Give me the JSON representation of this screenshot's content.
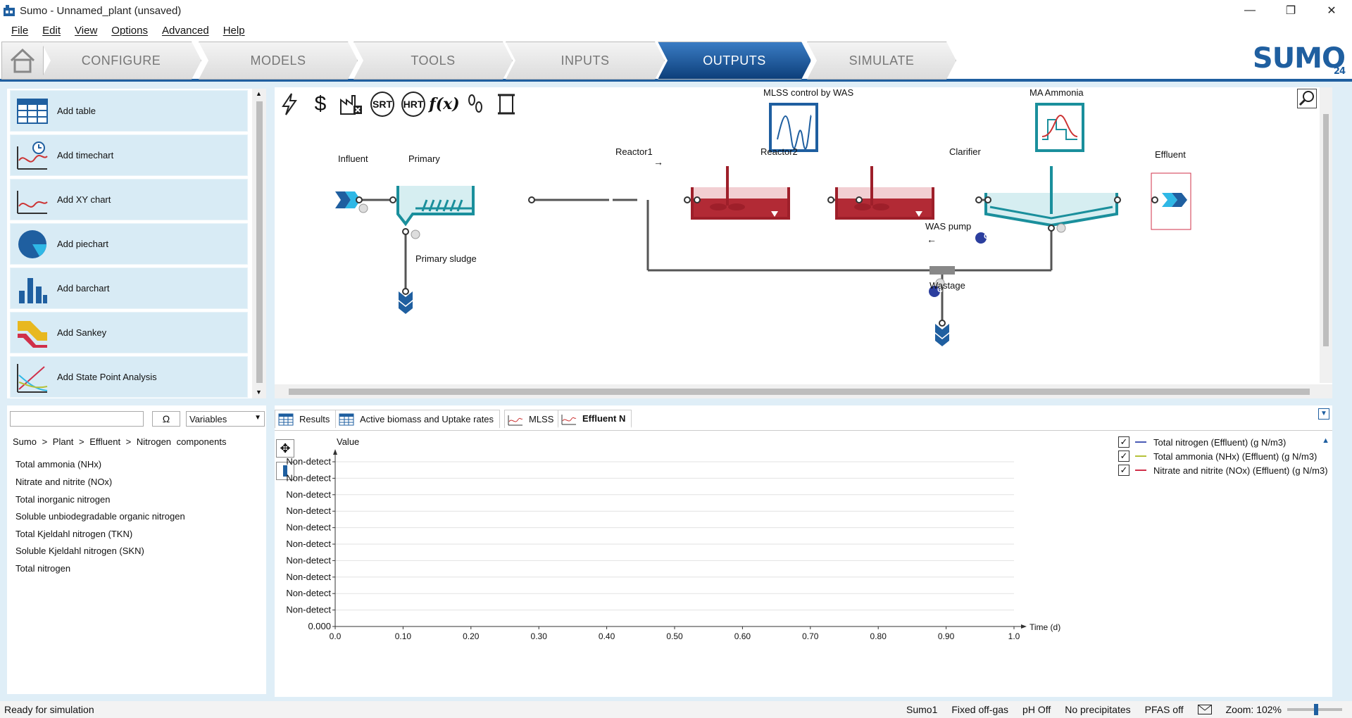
{
  "window": {
    "title": "Sumo - Unnamed_plant (unsaved)",
    "minimize": "—",
    "maximize": "❐",
    "close": "✕"
  },
  "menu": [
    "File",
    "Edit",
    "View",
    "Options",
    "Advanced",
    "Help"
  ],
  "ribbon": {
    "tabs": [
      "CONFIGURE",
      "MODELS",
      "TOOLS",
      "INPUTS",
      "OUTPUTS",
      "SIMULATE"
    ],
    "active_tab": "OUTPUTS",
    "logo": "SUMO",
    "logo_version": "24"
  },
  "add_panel": {
    "items": [
      "Add table",
      "Add timechart",
      "Add XY chart",
      "Add piechart",
      "Add barchart",
      "Add Sankey",
      "Add State Point Analysis"
    ]
  },
  "toolbar_icons": [
    "lightning-icon",
    "dollar-icon",
    "factory-x-icon",
    "SRT",
    "HRT",
    "f(x)-icon",
    "footprint-icon",
    "scroll-icon"
  ],
  "toolbar_labels": {
    "srt": "SRT",
    "hrt": "HRT"
  },
  "flowsheet": {
    "controllers": [
      {
        "label": "MLSS control by WAS"
      },
      {
        "label": "MA Ammonia"
      }
    ],
    "units": {
      "influent": "Influent",
      "primary": "Primary",
      "reactor1": "Reactor1",
      "reactor2": "Reactor2",
      "clarifier": "Clarifier",
      "effluent": "Effluent",
      "primary_sludge": "Primary sludge",
      "was_pump": "WAS pump",
      "wastage": "Wastage"
    },
    "controller_badge": "C",
    "arrow_right": "→",
    "arrow_left": "←"
  },
  "variable_browser": {
    "search_value": "",
    "omega": "Ω",
    "filter": "Variables",
    "breadcrumb": "Sumo  >  Plant  >  Effluent  >  Nitrogen components",
    "items": [
      "Total ammonia (NHx)",
      "Nitrate and nitrite (NOx)",
      "Total inorganic nitrogen",
      "Soluble unbiodegradable organic nitrogen",
      "Total Kjeldahl nitrogen (TKN)",
      "Soluble Kjeldahl nitrogen (SKN)",
      "Total nitrogen"
    ]
  },
  "chart_tabs": [
    "Results",
    "Active biomass and Uptake rates",
    "MLSS",
    "Effluent N"
  ],
  "active_chart_tab": "Effluent N",
  "chart_data": {
    "type": "line",
    "title": "",
    "ylabel": "Value",
    "xlabel": "Time  (d)",
    "x_ticks": [
      "0.0",
      "0.10",
      "0.20",
      "0.30",
      "0.40",
      "0.50",
      "0.60",
      "0.70",
      "0.80",
      "0.90",
      "1.0"
    ],
    "y_ticks": [
      "0.000",
      "Non-detect",
      "Non-detect",
      "Non-detect",
      "Non-detect",
      "Non-detect",
      "Non-detect",
      "Non-detect",
      "Non-detect",
      "Non-detect",
      "Non-detect"
    ],
    "xlim": [
      0.0,
      1.0
    ],
    "grid": true,
    "legend_position": "top-right",
    "series": [
      {
        "name": "Total nitrogen (Effluent) (g N/m3)",
        "color": "#4a5bb5",
        "values": []
      },
      {
        "name": "Total ammonia (NHx) (Effluent) (g N/m3)",
        "color": "#b5c23a",
        "values": []
      },
      {
        "name": "Nitrate and nitrite (NOx) (Effluent) (g N/m3)",
        "color": "#d0304a",
        "values": []
      }
    ]
  },
  "status": {
    "message": "Ready for simulation",
    "items": [
      "Sumo1",
      "Fixed off-gas",
      "pH Off",
      "No precipitates",
      "PFAS off"
    ],
    "zoom": "Zoom: 102%"
  },
  "colors": {
    "accent": "#1f5fa0",
    "panel_bg": "#dfeef7",
    "teal": "#1a8f9c",
    "reactor": "#9e1f2a"
  }
}
